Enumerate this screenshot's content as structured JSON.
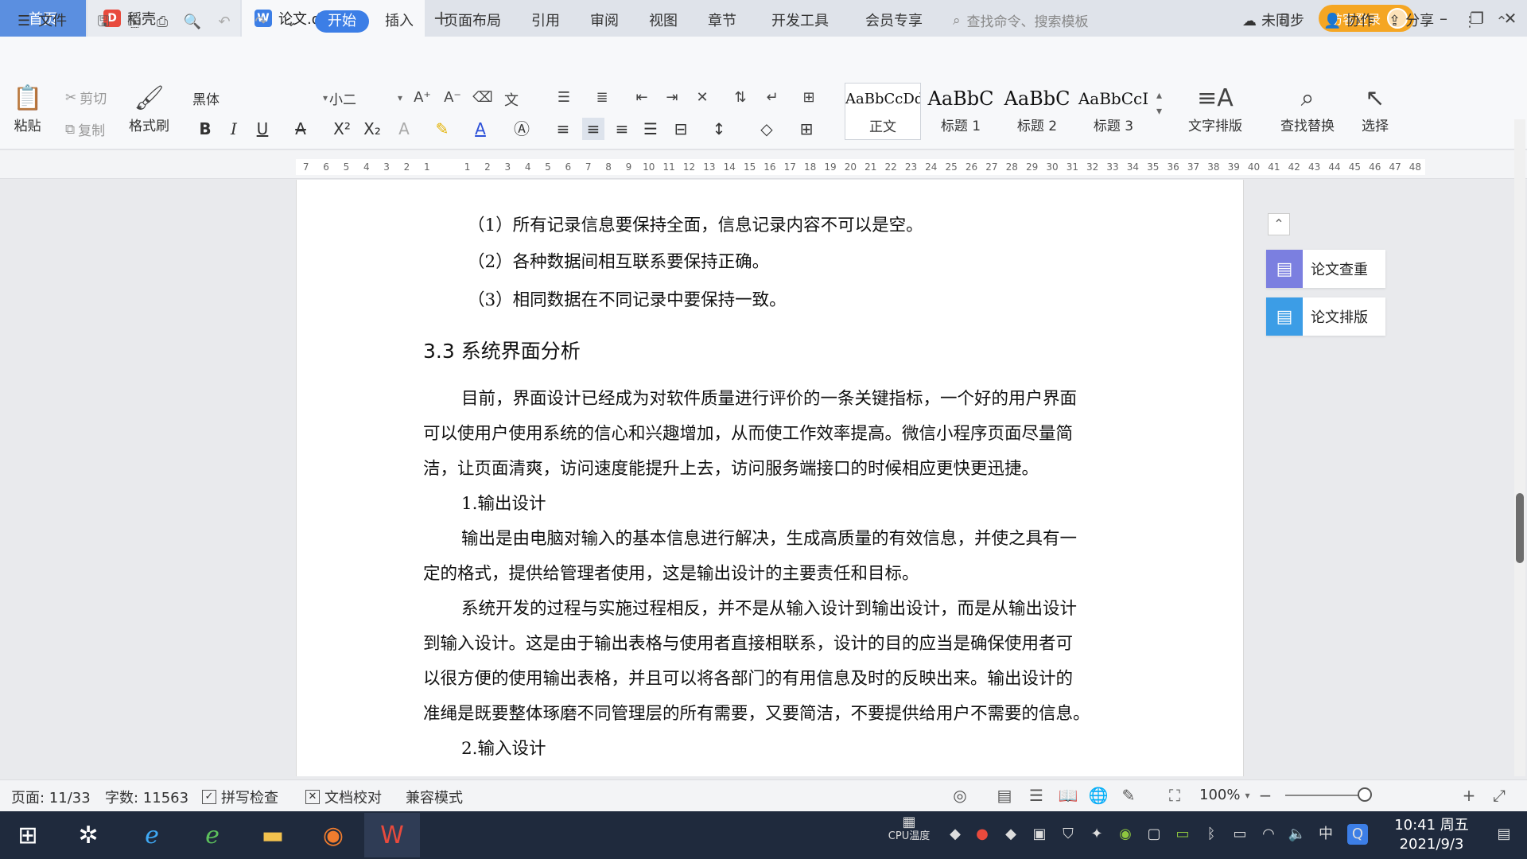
{
  "titlebar": {
    "tabs": [
      {
        "label": "首页"
      },
      {
        "label": "稻壳"
      },
      {
        "label": "论文.doc"
      }
    ],
    "new_tab": "+",
    "visitor_login": "访客登录"
  },
  "menu": {
    "file": "文件",
    "items": [
      "开始",
      "插入",
      "页面布局",
      "引用",
      "审阅",
      "视图",
      "章节",
      "开发工具",
      "会员专享"
    ],
    "search": "查找命令、搜索模板",
    "sync": "未同步",
    "collab": "协作",
    "share": "分享"
  },
  "ribbon": {
    "paste": "粘贴",
    "cut": "剪切",
    "copy": "复制",
    "format_painter": "格式刷",
    "font_name": "黑体",
    "font_size": "小二",
    "styles": [
      {
        "sample": "AaBbCcDd",
        "name": "正文"
      },
      {
        "sample": "AaBbC",
        "name": "标题 1"
      },
      {
        "sample": "AaBbC",
        "name": "标题 2"
      },
      {
        "sample": "AaBbCcI",
        "name": "标题 3"
      }
    ],
    "text_layout": "文字排版",
    "find_replace": "查找替换",
    "select": "选择"
  },
  "ruler": {
    "ticks": [
      "7",
      "6",
      "5",
      "4",
      "3",
      "2",
      "1",
      "",
      "1",
      "2",
      "3",
      "4",
      "5",
      "6",
      "7",
      "8",
      "9",
      "10",
      "11",
      "12",
      "13",
      "14",
      "15",
      "16",
      "17",
      "18",
      "19",
      "20",
      "21",
      "22",
      "23",
      "24",
      "25",
      "26",
      "27",
      "28",
      "29",
      "30",
      "31",
      "32",
      "33",
      "34",
      "35",
      "36",
      "37",
      "38",
      "39",
      "40",
      "41",
      "42",
      "43",
      "44",
      "45",
      "46",
      "47",
      "48"
    ]
  },
  "document": {
    "list1": "（1）所有记录信息要保持全面，信息记录内容不可以是空。",
    "list2": "（2）各种数据间相互联系要保持正确。",
    "list3": "（3）相同数据在不同记录中要保持一致。",
    "heading": "3.3 系统界面分析",
    "p1_l1": "目前，界面设计已经成为对软件质量进行评价的一条关键指标，一个好的用户界面",
    "p1_l2": "可以使用户使用系统的信心和兴趣增加，从而使工作效率提高。微信小程序页面尽量简",
    "p1_l3": "洁，让页面清爽，访问速度能提升上去，访问服务端接口的时候相应更快更迅捷。",
    "sub1": "1.输出设计",
    "p2_l1": "输出是由电脑对输入的基本信息进行解决，生成高质量的有效信息，并使之具有一",
    "p2_l2": "定的格式，提供给管理者使用，这是输出设计的主要责任和目标。",
    "p3_l1": "系统开发的过程与实施过程相反，并不是从输入设计到输出设计，而是从输出设计",
    "p3_l2": "到输入设计。这是由于输出表格与使用者直接相联系，设计的目的应当是确保使用者可",
    "p3_l3": "以很方便的使用输出表格，并且可以将各部门的有用信息及时的反映出来。输出设计的",
    "p3_l4": "准绳是既要整体琢磨不同管理层的所有需要，又要简洁，不要提供给用户不需要的信息。",
    "sub2": "2.输入设计"
  },
  "side_panel": {
    "check": "论文查重",
    "layout": "论文排版"
  },
  "status": {
    "page": "页面: 11/33",
    "words": "字数: 11563",
    "spell": "拼写检查",
    "proof": "文档校对",
    "compat": "兼容模式",
    "zoom": "100%"
  },
  "taskbar": {
    "cpu": "CPU温度",
    "ime": "中",
    "time": "10:41 周五",
    "date": "2021/9/3"
  },
  "colors": {
    "accent": "#3c7ee6",
    "visitor": "#f5a623",
    "taskbar": "#1f2a3d"
  }
}
